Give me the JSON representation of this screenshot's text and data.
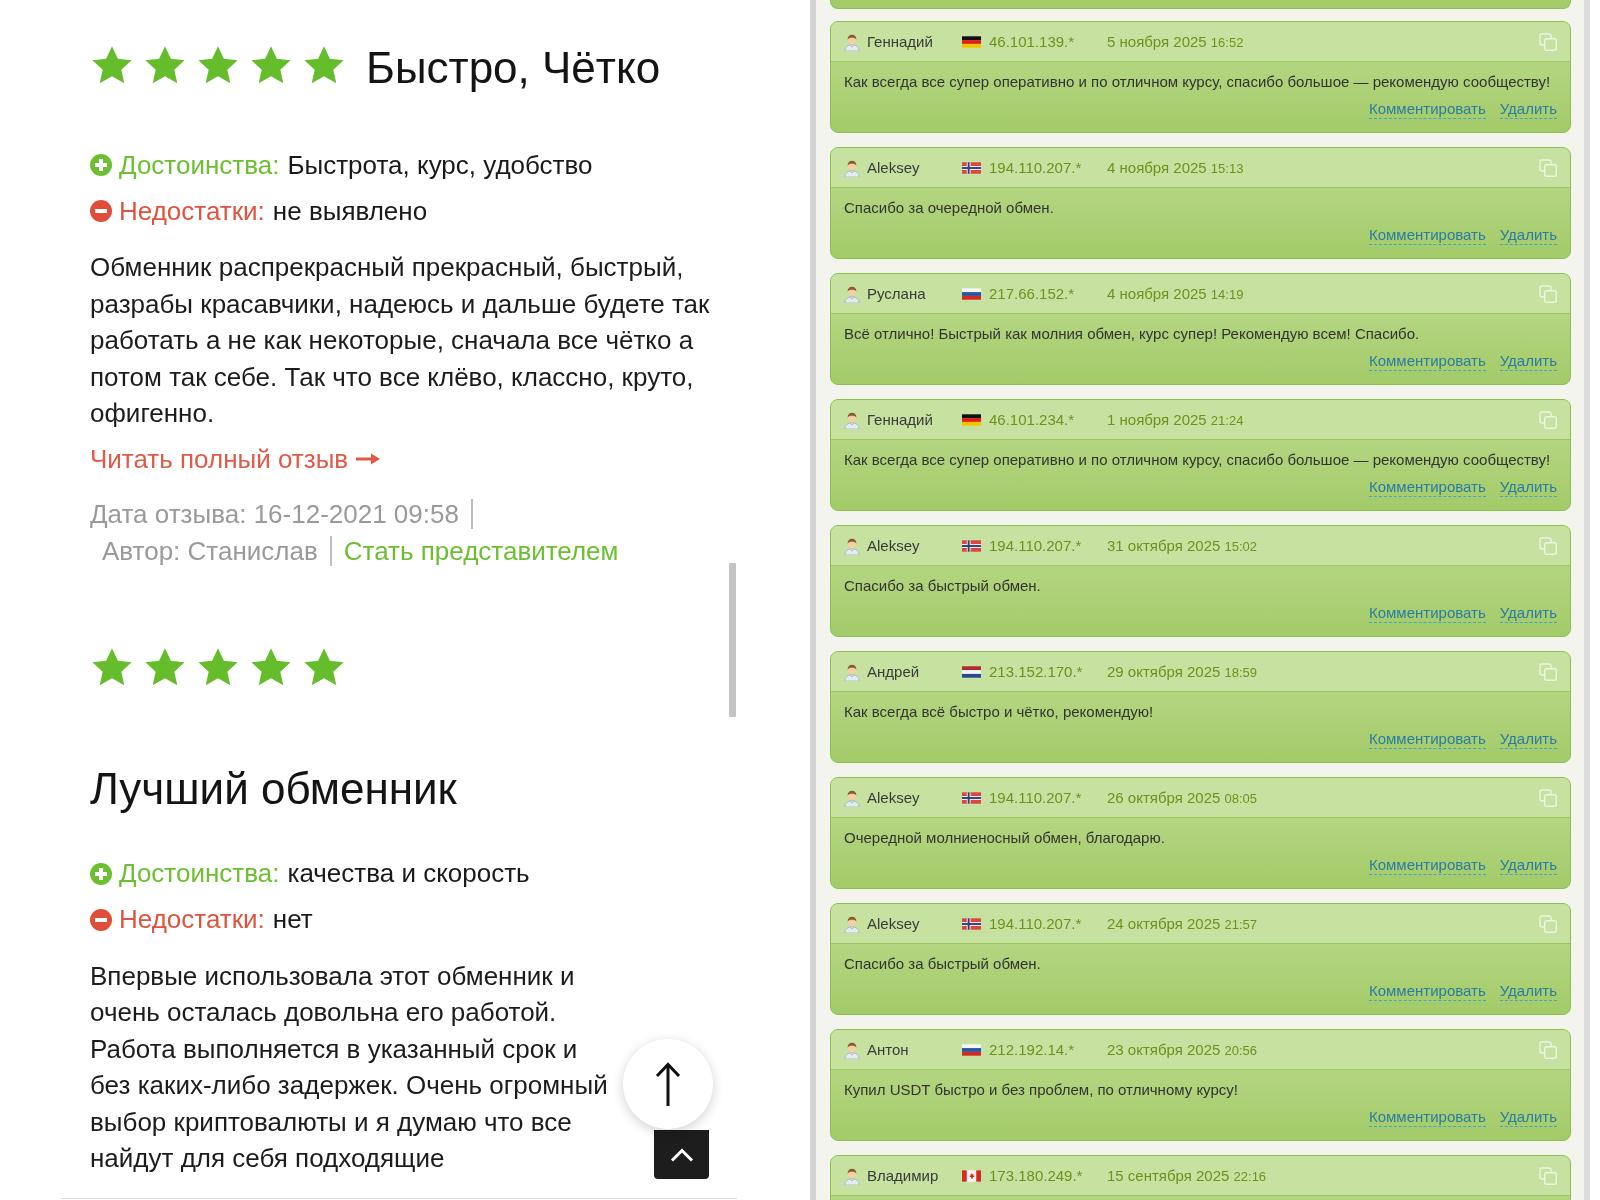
{
  "reviews": [
    {
      "stars": 5,
      "title": "Быстро, Чётко",
      "points": [
        {
          "kind": "pros",
          "label": "Достоинства:",
          "text": "Быстрота, курс, удобство"
        },
        {
          "kind": "cons",
          "label": "Недостатки:",
          "text": "не выявлено"
        }
      ],
      "body": "Обменник распрекрасный прекрасный, быстрый, разрабы красавчики, надеюсь и дальше будете так работать а не как некоторые, сначала все чётко а потом так себе. Так что все клёво, классно, круто, офигенно.",
      "read_more": "Читать полный отзыв",
      "date": "Дата отзыва: 16-12-2021 09:58",
      "author": "Автор: Станислав",
      "rep_link": "Стать представителем"
    },
    {
      "stars": 5,
      "title": "Лучший обменник",
      "points": [
        {
          "kind": "pros",
          "label": "Достоинства:",
          "text": "качества и скорость"
        },
        {
          "kind": "cons",
          "label": "Недостатки:",
          "text": "нет"
        }
      ],
      "body": "Впервые использовала этот обменник и очень осталась довольна его работой. Работа выполняется в указанный срок и без каких-либо задержек. Очень огромный выбор криптовалюты и я думаю что все найдут для себя подходящие"
    }
  ],
  "comments": [
    {
      "name": "Геннадий",
      "kind": "germany",
      "ip": "46.101.139.*",
      "date": "5 ноября 2025",
      "time": "16:52",
      "text": "Как всегда все супер оперативно и по отличном курсу, спасибо большое — рекомендую сообществу!",
      "actions": [
        "Комментировать",
        "Удалить"
      ]
    },
    {
      "name": "Aleksey",
      "kind": "norway",
      "ip": "194.110.207.*",
      "date": "4 ноября 2025",
      "time": "15:13",
      "text": "Спасибо за очередной обмен.",
      "actions": [
        "Комментировать",
        "Удалить"
      ]
    },
    {
      "name": "Руслана",
      "kind": "russia",
      "ip": "217.66.152.*",
      "date": "4 ноября 2025",
      "time": "14:19",
      "text": "Всё отлично! Быстрый как молния обмен, курс супер! Рекомендую всем! Спасибо.",
      "actions": [
        "Комментировать",
        "Удалить"
      ]
    },
    {
      "name": "Геннадий",
      "kind": "germany",
      "ip": "46.101.234.*",
      "date": "1 ноября 2025",
      "time": "21:24",
      "text": "Как всегда все супер оперативно и по отличном курсу, спасибо большое — рекомендую сообществу!",
      "actions": [
        "Комментировать",
        "Удалить"
      ]
    },
    {
      "name": "Aleksey",
      "kind": "norway",
      "ip": "194.110.207.*",
      "date": "31 октября 2025",
      "time": "15:02",
      "text": "Спасибо за быстрый обмен.",
      "actions": [
        "Комментировать",
        "Удалить"
      ]
    },
    {
      "name": "Андрей",
      "kind": "netherlands",
      "ip": "213.152.170.*",
      "date": "29 октября 2025",
      "time": "18:59",
      "text": "Как всегда всё быстро и чётко, рекомендую!",
      "actions": [
        "Комментировать",
        "Удалить"
      ]
    },
    {
      "name": "Aleksey",
      "kind": "norway",
      "ip": "194.110.207.*",
      "date": "26 октября 2025",
      "time": "08:05",
      "text": "Очередной молниеносный обмен, благодарю.",
      "actions": [
        "Комментировать",
        "Удалить"
      ]
    },
    {
      "name": "Aleksey",
      "kind": "norway",
      "ip": "194.110.207.*",
      "date": "24 октября 2025",
      "time": "21:57",
      "text": "Спасибо за быстрый обмен.",
      "actions": [
        "Комментировать",
        "Удалить"
      ]
    },
    {
      "name": "Антон",
      "kind": "russia",
      "ip": "212.192.14.*",
      "date": "23 октября 2025",
      "time": "20:56",
      "text": "Купил USDT быстро и без проблем, по отличному курсу!",
      "actions": [
        "Комментировать",
        "Удалить"
      ]
    },
    {
      "name": "Владимир",
      "kind": "canada",
      "ip": "173.180.249.*",
      "date": "15 сентября 2025",
      "time": "22:16"
    }
  ]
}
